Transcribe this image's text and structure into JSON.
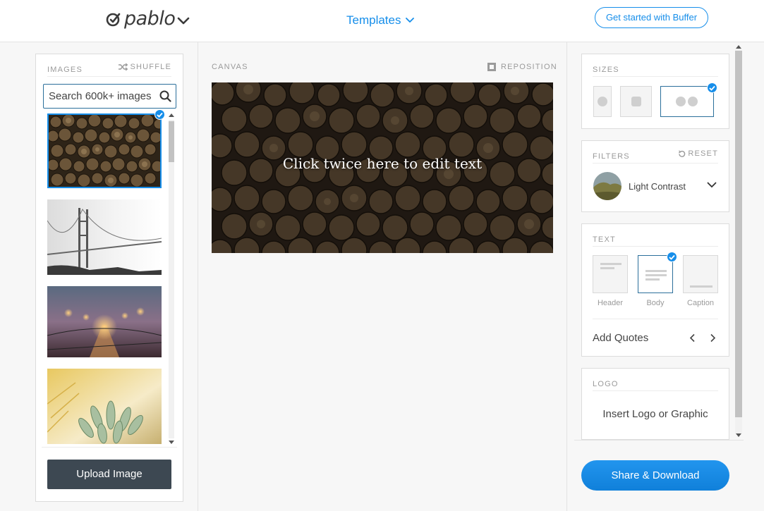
{
  "header": {
    "logo_text": "pablo",
    "templates_label": "Templates",
    "cta_label": "Get started with Buffer"
  },
  "images_panel": {
    "title": "IMAGES",
    "shuffle_label": "SHUFFLE",
    "search_placeholder": "Search 600k+ images",
    "upload_label": "Upload Image"
  },
  "canvas": {
    "title": "CANVAS",
    "reposition_label": "REPOSITION",
    "text": "Click twice here to edit text"
  },
  "sizes": {
    "title": "SIZES",
    "options": [
      "pinterest",
      "instagram",
      "facebook-twitter"
    ],
    "selected": "facebook-twitter"
  },
  "filters": {
    "title": "FILTERS",
    "reset_label": "RESET",
    "selected": "Light Contrast"
  },
  "text_panel": {
    "title": "TEXT",
    "options": [
      "Header",
      "Body",
      "Caption"
    ],
    "selected": "Body",
    "add_quotes_label": "Add Quotes"
  },
  "logo_panel": {
    "title": "LOGO",
    "insert_label": "Insert Logo or Graphic"
  },
  "share_label": "Share & Download",
  "colors": {
    "accent": "#168eea",
    "dark_button": "#3d4852",
    "text": "#444444",
    "muted": "#9a9a9a"
  }
}
